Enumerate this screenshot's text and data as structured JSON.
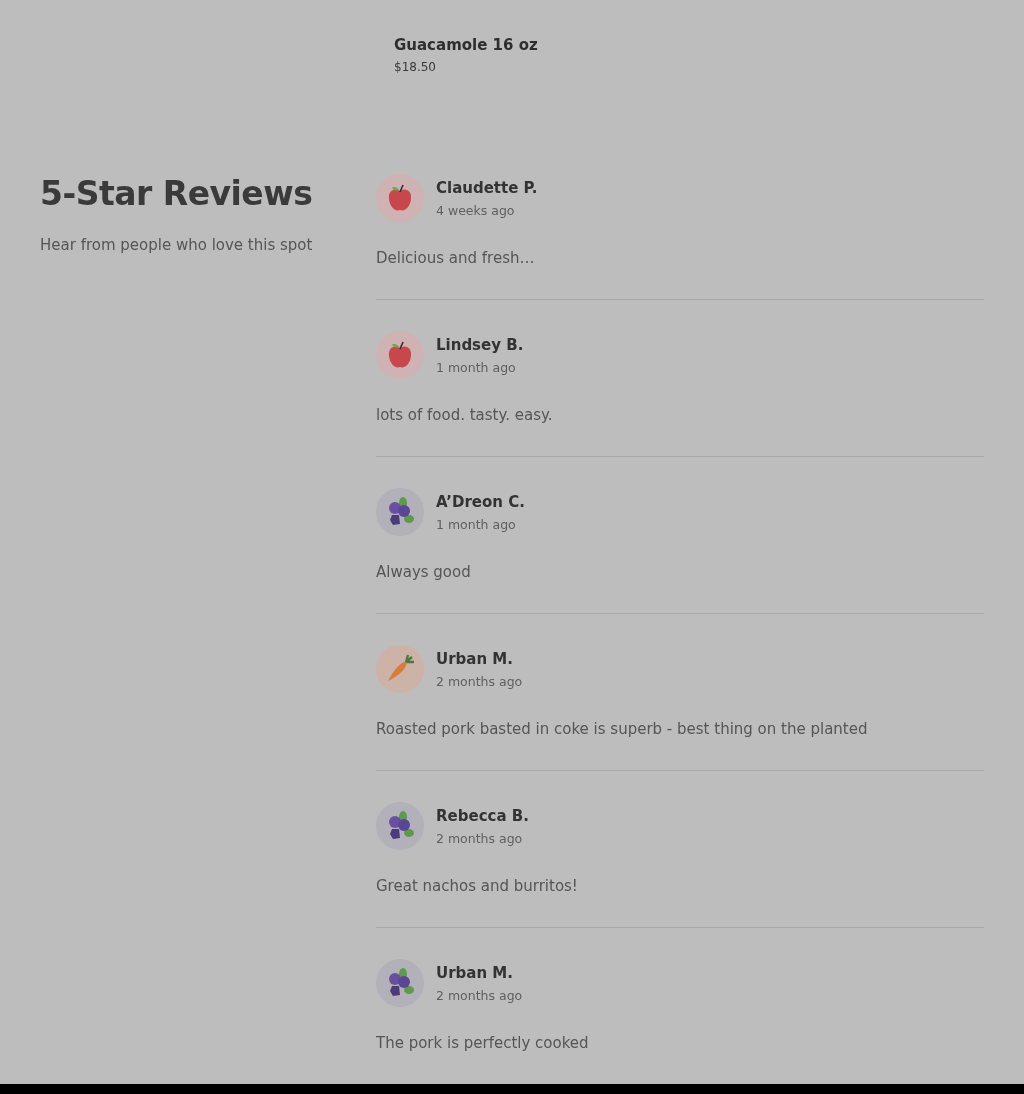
{
  "menu_item": {
    "name": "Guacamole 16 oz",
    "price": "$18.50"
  },
  "reviews_section": {
    "title": "5-Star Reviews",
    "subtitle": "Hear from people who love this spot",
    "reviews": [
      {
        "name": "Claudette P.",
        "time": "4 weeks ago",
        "text": "Delicious and fresh…",
        "avatar": {
          "kind": "apple"
        }
      },
      {
        "name": "Lindsey B.",
        "time": "1 month ago",
        "text": "lots of food. tasty. easy.",
        "avatar": {
          "kind": "apple"
        }
      },
      {
        "name": "A’Dreon C.",
        "time": "1 month ago",
        "text": "Always good",
        "avatar": {
          "kind": "berries"
        }
      },
      {
        "name": "Urban M.",
        "time": "2 months ago",
        "text": "Roasted pork basted in coke is superb - best thing on the planted",
        "avatar": {
          "kind": "carrot"
        }
      },
      {
        "name": "Rebecca B.",
        "time": "2 months ago",
        "text": "Great nachos and burritos!",
        "avatar": {
          "kind": "berries"
        }
      },
      {
        "name": "Urban M.",
        "time": "2 months ago",
        "text": "The pork is perfectly cooked",
        "avatar": {
          "kind": "berries"
        }
      }
    ]
  }
}
